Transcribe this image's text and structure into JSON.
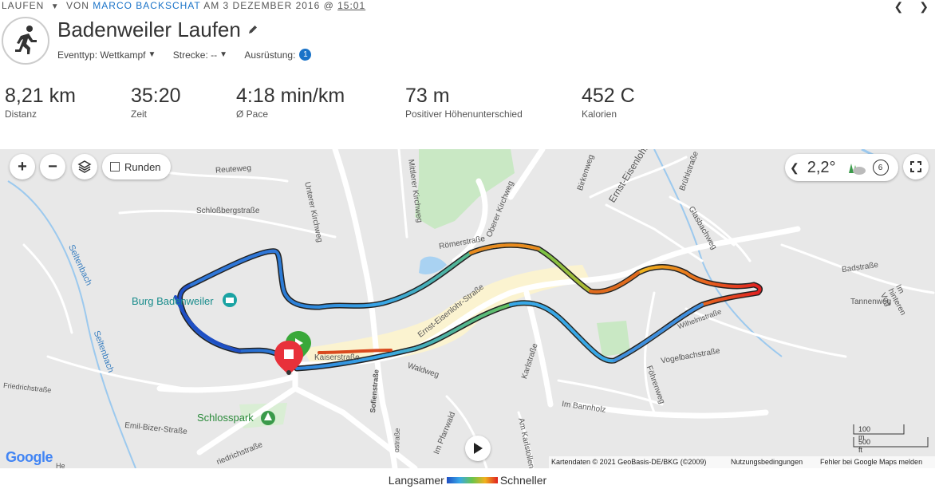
{
  "header": {
    "activity_type": "LAUFEN",
    "by_label": "VON",
    "author": "MARCO BACKSCHAT",
    "date_prefix": "AM 3 DEZEMBER 2016 @",
    "time": "15:01"
  },
  "nav": {
    "prev_icon": "chevron-left-icon",
    "next_icon": "chevron-right-icon"
  },
  "activity": {
    "icon": "running-person-icon",
    "title": "Badenweiler Laufen",
    "event_type_label": "Eventtyp:",
    "event_type_value": "Wettkampf",
    "course_label": "Strecke:",
    "course_value": "--",
    "gear_label": "Ausrüstung:",
    "gear_count": "1"
  },
  "stats": [
    {
      "value": "8,21 km",
      "label": "Distanz"
    },
    {
      "value": "35:20",
      "label": "Zeit"
    },
    {
      "value": "4:18 min/km",
      "label": "Ø Pace"
    },
    {
      "value": "73 m",
      "label": "Positiver Höhenunterschied"
    },
    {
      "value": "452 C",
      "label": "Kalorien"
    }
  ],
  "map": {
    "laps_label": "Runden",
    "temperature": "2,2°",
    "wind_speed": "6",
    "weather_icon": "partly-cloudy-icon",
    "places": {
      "burg": "Burg Badenweiler",
      "schlosspark": "Schlosspark"
    },
    "streets": {
      "reuteweg": "Reuteweg",
      "schlossberg": "Schloßbergstraße",
      "unterer_kirchweg": "Unterer Kirchweg",
      "mittlerer_kirchweg": "Mittlerer Kirchweg",
      "oberer_kirchweg": "Oberer Kirchweg",
      "roemer": "Römerstraße",
      "ernst1": "Ernst-Eisenlohr-Straße",
      "ernst2": "Ernst-Eisenlohr-",
      "birkenweg": "Birkenweg",
      "bruehl": "Brühlstraße",
      "glasbach": "Glasbachweg",
      "badstr": "Badstraße",
      "tannenweg": "Tannenweg",
      "hinteren": "Im hinteren Vog",
      "wilhelm": "Wilhelmstraße",
      "vogelbach": "Vogelbachstraße",
      "foehren": "Föhrenweg",
      "karl": "Karlstraße",
      "bannholz": "Im Bannholz",
      "karlstollen": "Am Karlstollen",
      "pfarrwald": "Im Pfarrwald",
      "sofien": "Sofienstraße",
      "waldweg": "Waldweg",
      "kaiser": "Kaiserstraße",
      "friedrich": "Friedrichstraße",
      "friedrich2": "riedrichstraße",
      "emil": "Emil-Bizer-Straße",
      "seltenbach1": "Seltenbach",
      "seltenbach2": "Seltenbach",
      "he": "He",
      "ostr": "ostraße"
    },
    "google_logo": "Google",
    "attribution": "Kartendaten © 2021 GeoBasis-DE/BKG (©2009)",
    "terms": "Nutzungsbedingungen",
    "report": "Fehler bei Google Maps melden",
    "scale_metric": "100 m",
    "scale_imperial": "500 ft"
  },
  "legend": {
    "slow": "Langsamer",
    "fast": "Schneller"
  },
  "colors": {
    "accent": "#1a73c8",
    "slow": "#1f4fc4",
    "fast": "#e02020",
    "start": "#3aa83a",
    "finish": "#e8313a"
  }
}
